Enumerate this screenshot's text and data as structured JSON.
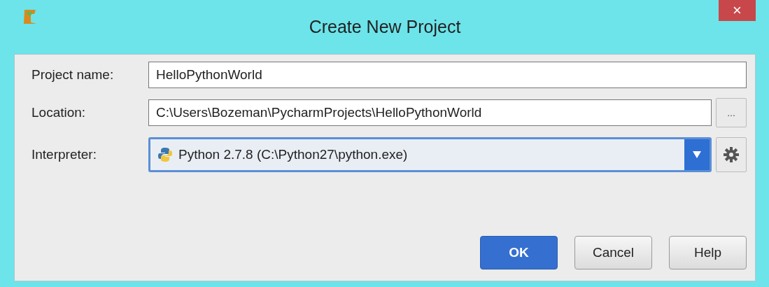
{
  "window": {
    "title": "Create New Project",
    "close": "×"
  },
  "fields": [
    {
      "kind": "text",
      "label": "Project name:",
      "value": "HelloPythonWorld"
    },
    {
      "kind": "path",
      "label": "Location:",
      "value": "C:\\Users\\Bozeman\\PycharmProjects\\HelloPythonWorld",
      "browse": "..."
    },
    {
      "kind": "combo",
      "label": "Interpreter:",
      "value": "Python 2.7.8 (C:\\Python27\\python.exe)",
      "focused": true
    }
  ],
  "buttons": [
    {
      "label": "OK",
      "default": true
    },
    {
      "label": "Cancel",
      "default": false
    },
    {
      "label": "Help",
      "default": false
    }
  ]
}
